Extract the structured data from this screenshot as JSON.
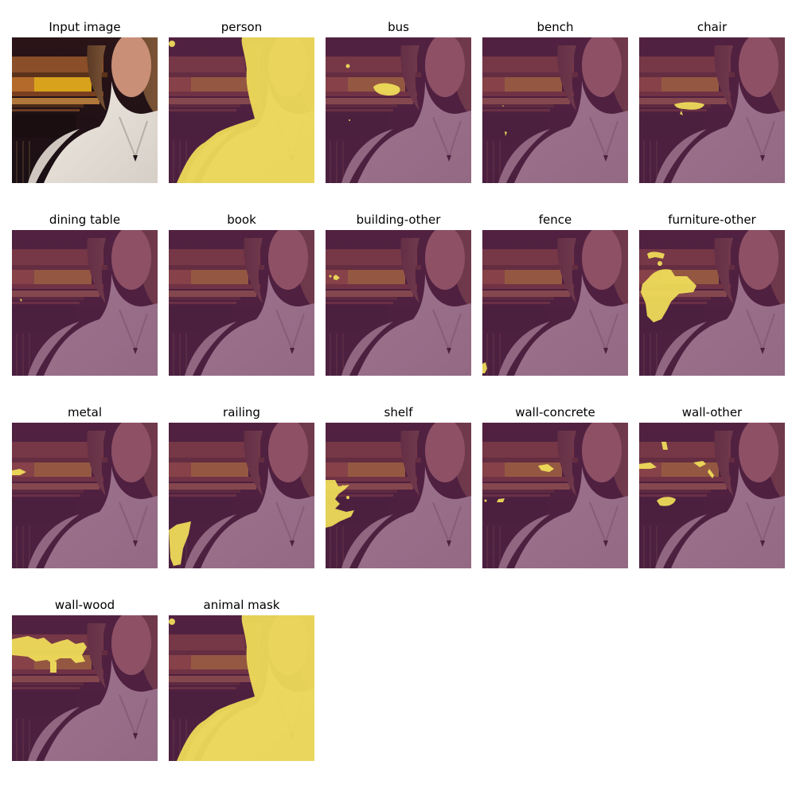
{
  "figure": {
    "panels": [
      {
        "title": "Input image",
        "kind": "input"
      },
      {
        "title": "person",
        "kind": "person"
      },
      {
        "title": "bus",
        "kind": "bus"
      },
      {
        "title": "bench",
        "kind": "bench"
      },
      {
        "title": "chair",
        "kind": "chair"
      },
      {
        "title": "dining table",
        "kind": "dining_table"
      },
      {
        "title": "book",
        "kind": "book"
      },
      {
        "title": "building-other",
        "kind": "building_other"
      },
      {
        "title": "fence",
        "kind": "fence"
      },
      {
        "title": "furniture-other",
        "kind": "furniture_other"
      },
      {
        "title": "metal",
        "kind": "metal"
      },
      {
        "title": "railing",
        "kind": "railing"
      },
      {
        "title": "shelf",
        "kind": "shelf"
      },
      {
        "title": "wall-concrete",
        "kind": "wall_concrete"
      },
      {
        "title": "wall-other",
        "kind": "wall_other"
      },
      {
        "title": "wall-wood",
        "kind": "wall_wood"
      },
      {
        "title": "animal mask",
        "kind": "person"
      }
    ],
    "colors": {
      "mask": "#f2e05a",
      "overlay_tint": "#6a2a5a"
    }
  }
}
